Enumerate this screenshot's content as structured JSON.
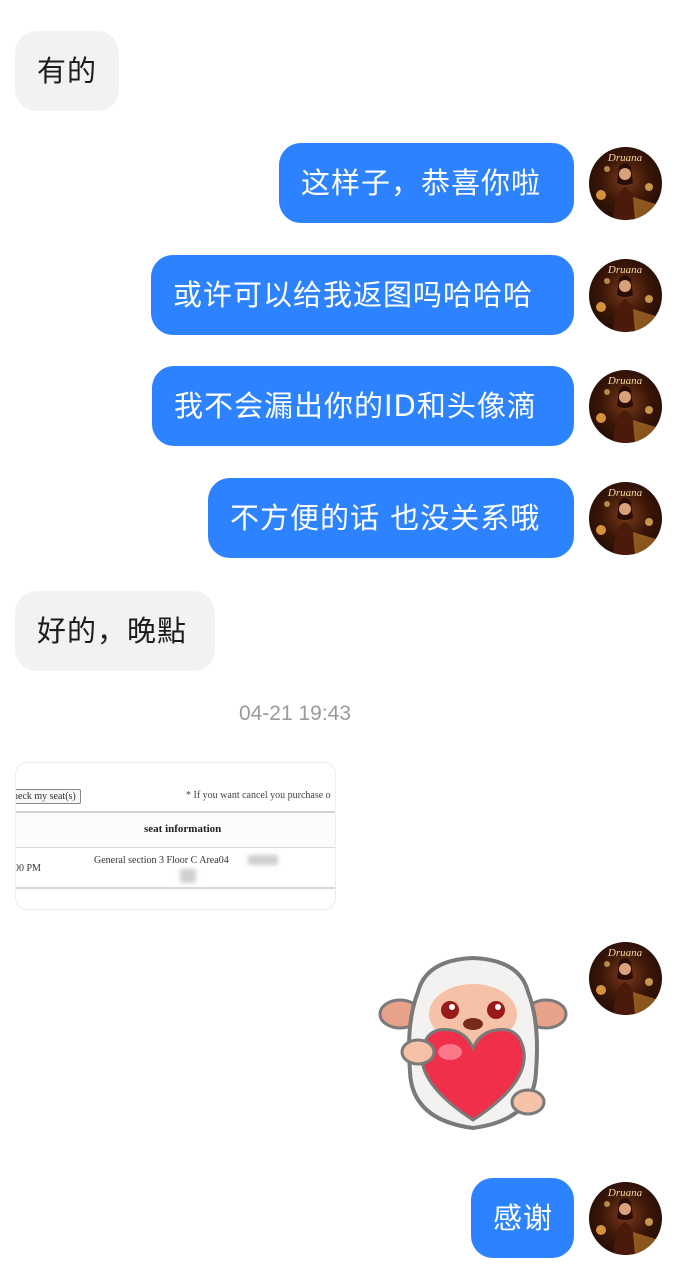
{
  "messages": [
    {
      "side": "in",
      "text": "有的"
    },
    {
      "side": "out",
      "text": "这样子，恭喜你啦"
    },
    {
      "side": "out",
      "text": "或许可以给我返图吗哈哈哈"
    },
    {
      "side": "out",
      "text": "我不会漏出你的ID和头像滴"
    },
    {
      "side": "out",
      "text": "不方便的话 也没关系哦"
    },
    {
      "side": "in",
      "text": "好的，晚點"
    },
    {
      "side": "out",
      "text": "感谢"
    }
  ],
  "timestamp": "04-21 19:43",
  "avatar": {
    "label": "Druana"
  },
  "ticket": {
    "button": "heck my seat(s)",
    "note": "* If you want cancel you purchase o",
    "header": "seat information",
    "time": "00 PM",
    "seat": "General section 3 Floor C Area04"
  },
  "colors": {
    "outgoing_bubble": "#2d83ff",
    "incoming_bubble": "#f2f2f2",
    "timestamp_text": "#9a9a9a"
  },
  "sticker": {
    "icon": "sheep-holding-heart-sticker"
  }
}
